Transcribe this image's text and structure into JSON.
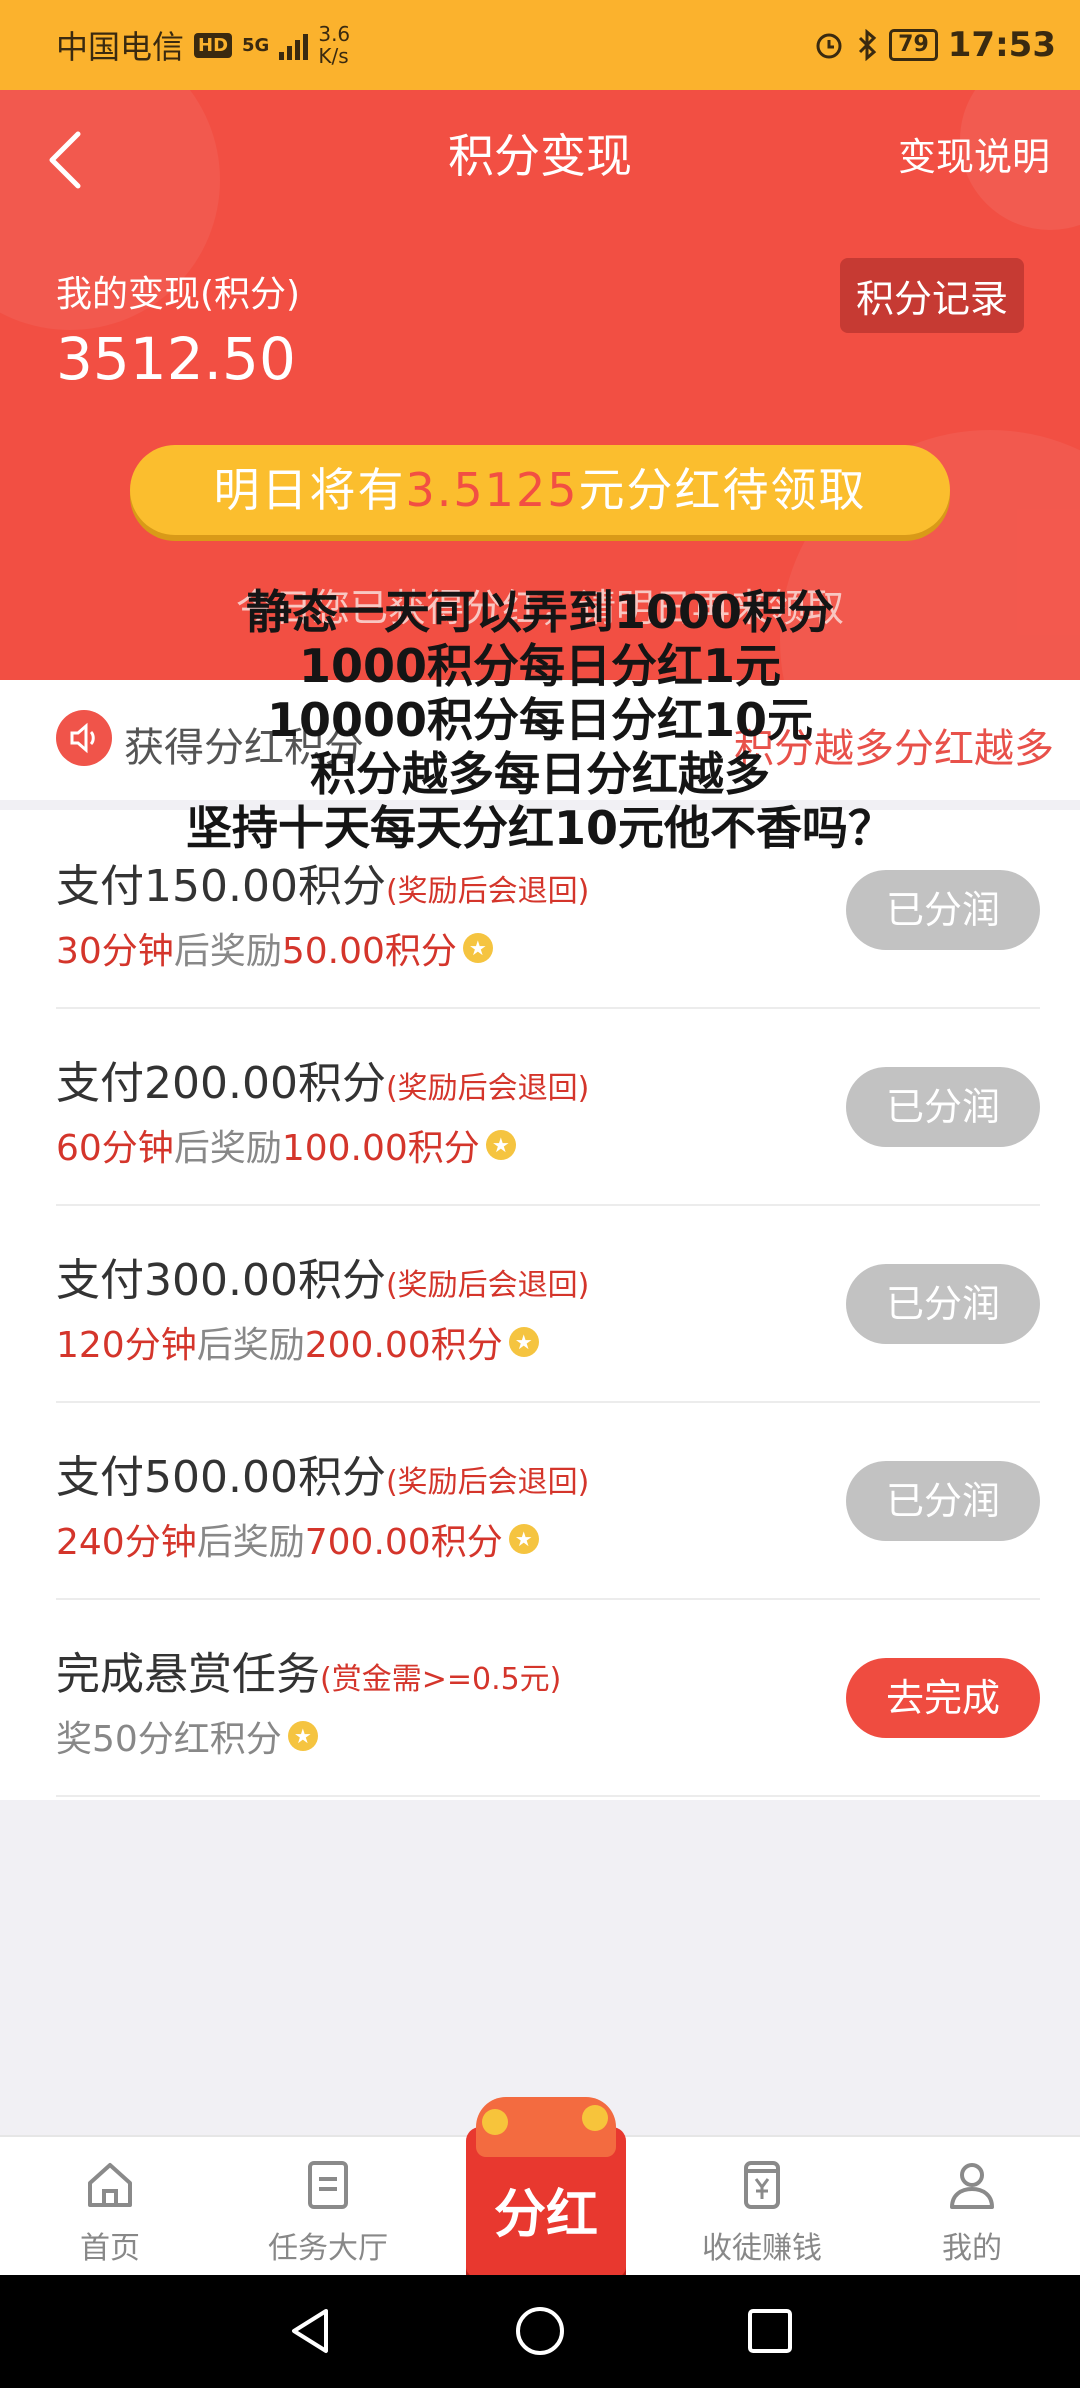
{
  "status_bar": {
    "carrier": "中国电信",
    "hd": "HD",
    "network": "5G",
    "speed_value": "3.6",
    "speed_unit": "K/s",
    "battery": "79",
    "time": "17:53"
  },
  "header": {
    "title": "积分变现",
    "right_link": "变现说明",
    "my_label": "我的变现(积分)",
    "my_value": "3512.50",
    "record_button": "积分记录",
    "banner_prefix": "明日将有",
    "banner_amount": "3.5125",
    "banner_suffix": "元分红待领取",
    "notice": "今日您已获得分红，请明日再来领取"
  },
  "strip": {
    "label": "获得分红积分",
    "marquee": "积分越多分红越多"
  },
  "overlay_lines": [
    "静态一天可以弄到1000积分",
    "1000积分每日分红1元",
    "10000积分每日分红10元",
    "积分越多每日分红越多",
    "坚持十天每天分红10元他不香吗？"
  ],
  "items": [
    {
      "title": "支付150.00积分",
      "note": "(奖励后会退回)",
      "time": "30分钟",
      "mid": "后奖励",
      "reward": "50.00积分",
      "button": "已分润"
    },
    {
      "title": "支付200.00积分",
      "note": "(奖励后会退回)",
      "time": "60分钟",
      "mid": "后奖励",
      "reward": "100.00积分",
      "button": "已分润"
    },
    {
      "title": "支付300.00积分",
      "note": "(奖励后会退回)",
      "time": "120分钟",
      "mid": "后奖励",
      "reward": "200.00积分",
      "button": "已分润"
    },
    {
      "title": "支付500.00积分",
      "note": "(奖励后会退回)",
      "time": "240分钟",
      "mid": "后奖励",
      "reward": "700.00积分",
      "button": "已分润"
    },
    {
      "title": "完成悬赏任务",
      "note": "(赏金需>=0.5元)",
      "sub": "奖50分红积分",
      "button": "去完成"
    }
  ],
  "tabbar": {
    "home": "首页",
    "tasks": "任务大厅",
    "center": "分红",
    "recruit": "收徒赚钱",
    "mine": "我的"
  },
  "colors": {
    "status_bar": "#fbb22d",
    "header_red": "#f24f43",
    "banner_yellow": "#fbbe2e",
    "accent_red": "#d4352b",
    "disabled_gray": "#c2c2c2"
  }
}
